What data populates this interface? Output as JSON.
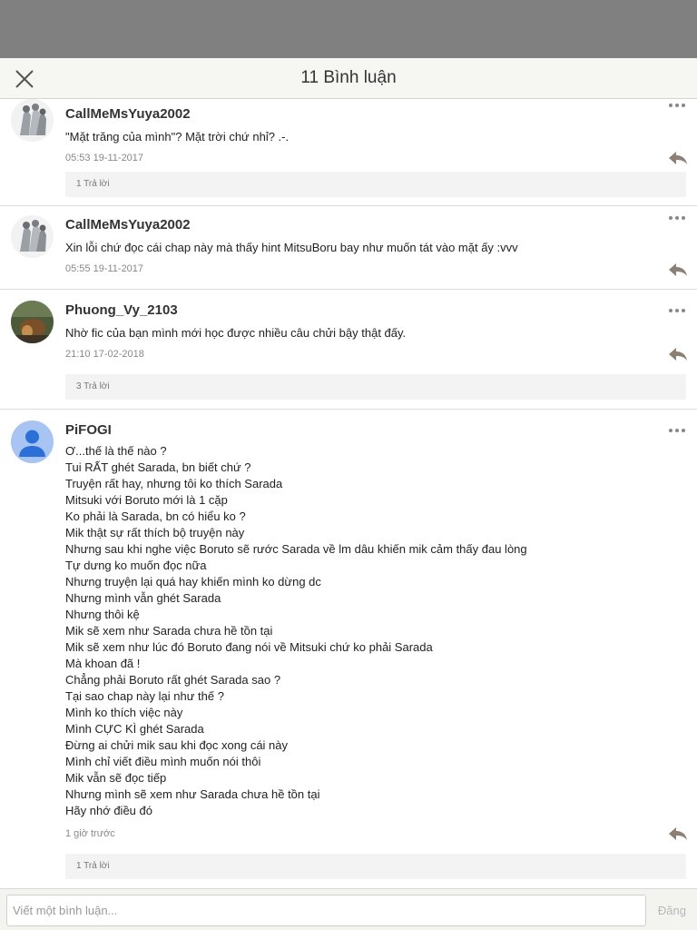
{
  "header": {
    "title": "11 Bình luận",
    "close_icon": "close-icon"
  },
  "comments": [
    {
      "author": "CallMeMsYuya2002",
      "text": "\"Mặt trăng của mình\"? Mặt trời chứ nhỉ? .-.",
      "time": "05:53 19-11-2017",
      "replies": "1 Trả lời",
      "avatar": "manga-figures"
    },
    {
      "author": "CallMeMsYuya2002",
      "text": "Xin lỗi chứ đọc cái chap này mà thấy hint MitsuBoru bay như muốn tát vào mặt ấy :vvv",
      "time": "05:55 19-11-2017",
      "avatar": "manga-figures"
    },
    {
      "author": "Phuong_Vy_2103",
      "text": "Nhờ fic của bạn mình mới học được nhiều câu chửi bậy thật đấy.",
      "time": "21:10 17-02-2018",
      "replies": "3 Trả lời",
      "avatar": "photo"
    },
    {
      "author": "PiFOGI",
      "text": "Ơ...thế là thế nào ?\nTui RẤT ghét Sarada, bn biết chứ ?\nTruyện rất hay, nhưng tôi ko thích Sarada\nMitsuki với Boruto mới là 1 cặp\nKo phải là Sarada, bn có hiểu ko ?\nMik thật sự rất thích bộ truyện này\nNhưng sau khi nghe việc Boruto sẽ rước Sarada về lm dâu khiến mik cảm thấy đau lòng\nTự dưng ko muốn đọc nữa\nNhưng truyện lại quá hay khiến mình ko dừng dc\nNhưng mình vẫn ghét Sarada\nNhưng thôi kệ\nMik sẽ xem như Sarada chưa hề tồn tại\nMik sẽ xem như lúc đó Boruto đang nói về Mitsuki chứ ko phải Sarada\nMà khoan đã !\nChẳng phải Boruto rất ghét Sarada sao ?\nTại sao chap này lại như thế ?\nMình ko thích việc này\nMình CỰC KÌ ghét Sarada\nĐừng ai chửi mik sau khi đọc xong cái này\nMình chỉ viết điều mình muốn nói thôi\nMik vẫn sẽ đọc tiếp\nNhưng mình sẽ xem như Sarada chưa hề tồn tại\nHãy nhớ điều đó",
      "time": "1 giờ trước",
      "replies": "1 Trả lời",
      "avatar": "default-user"
    }
  ],
  "footer": {
    "placeholder": "Viết một bình luận...",
    "post_label": "Đăng"
  },
  "colors": {
    "header_bg": "#f6f6f2",
    "reply_icon": "#8c7f76",
    "default_avatar": "#a7c4f2"
  }
}
